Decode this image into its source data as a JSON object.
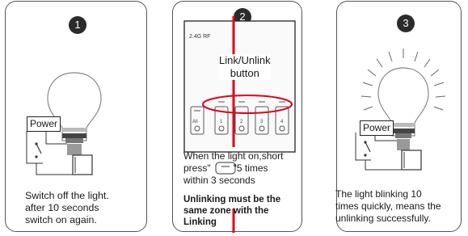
{
  "steps": [
    {
      "number": "1",
      "power_label": "Power",
      "caption_lines": [
        "Switch off the light.",
        "after 10 seconds",
        "switch on again."
      ]
    },
    {
      "number": "2",
      "panel_brand": "2.4G RF",
      "button_callout": [
        "Link/Unlink",
        "button"
      ],
      "zone_labels": [
        "All",
        "1",
        "2",
        "3",
        "4"
      ],
      "caption_lines": [
        "When the light on,short",
        "press\"",
        "\"5 times",
        "within 3 seconds"
      ],
      "caption_bold_lines": [
        "Unlinking must be the",
        "same zone with the",
        "Linking"
      ]
    },
    {
      "number": "3",
      "power_label": "Power",
      "caption_lines": [
        "The light blinking 10",
        "times quickly, means the",
        "unlinking successfully."
      ]
    }
  ],
  "colors": {
    "accent_red": "#e3001b",
    "outline": "#555555",
    "badge": "#2b2b2b"
  }
}
